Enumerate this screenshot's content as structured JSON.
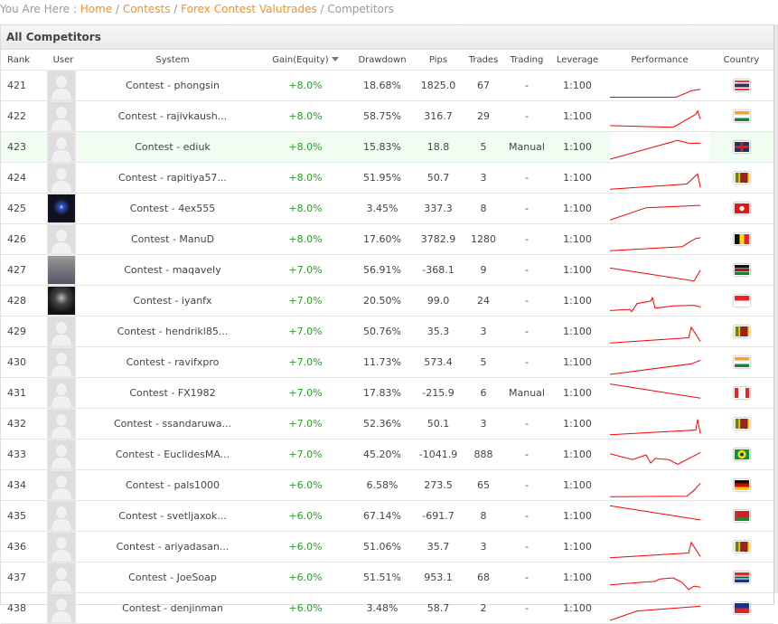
{
  "breadcrumb": {
    "prefix": "You Are Here :",
    "items": [
      "Home",
      "Contests",
      "Forex Contest Valutrades"
    ],
    "current": "Competitors"
  },
  "panel_title": "All Competitors",
  "columns": {
    "rank": "Rank",
    "user": "User",
    "system": "System",
    "gain": "Gain(Equity)",
    "drawdown": "Drawdown",
    "pips": "Pips",
    "trades": "Trades",
    "trading": "Trading",
    "leverage": "Leverage",
    "performance": "Performance",
    "country": "Country"
  },
  "colors": {
    "accent": "#f7931e",
    "gain": "#2a9d2a",
    "spark": "#ff0000",
    "highlight": "#f0fdf0"
  },
  "rows": [
    {
      "rank": "421",
      "avatar": "default",
      "system": "Contest - phongsin",
      "gain": "+8.0%",
      "drawdown": "18.68%",
      "pips": "1825.0",
      "trades": "67",
      "trading": "-",
      "leverage": "1:100",
      "country": "th",
      "perf": [
        [
          0,
          2
        ],
        [
          73,
          2
        ],
        [
          75,
          5
        ],
        [
          80,
          13
        ],
        [
          85,
          21
        ],
        [
          90,
          30
        ],
        [
          100,
          35
        ]
      ]
    },
    {
      "rank": "422",
      "avatar": "default",
      "system": "Contest - rajivkaush...",
      "gain": "+8.0%",
      "drawdown": "58.75%",
      "pips": "316.7",
      "trades": "29",
      "trading": "-",
      "leverage": "1:100",
      "country": "in",
      "perf": [
        [
          0,
          12
        ],
        [
          70,
          5
        ],
        [
          95,
          60
        ],
        [
          97,
          75
        ],
        [
          100,
          40
        ]
      ]
    },
    {
      "rank": "423",
      "avatar": "default",
      "system": "Contest - ediuk",
      "gain": "+8.0%",
      "drawdown": "15.83%",
      "pips": "18.8",
      "trades": "5",
      "trading": "Manual",
      "leverage": "1:100",
      "country": "gb",
      "highlight": true,
      "perf": [
        [
          0,
          0
        ],
        [
          75,
          80
        ],
        [
          87,
          68
        ],
        [
          100,
          68
        ]
      ]
    },
    {
      "rank": "424",
      "avatar": "default",
      "system": "Contest - rapitiya57...",
      "gain": "+8.0%",
      "drawdown": "51.95%",
      "pips": "50.7",
      "trades": "3",
      "trading": "-",
      "leverage": "1:100",
      "country": "lk",
      "perf": [
        [
          0,
          3
        ],
        [
          85,
          25
        ],
        [
          97,
          68
        ],
        [
          100,
          10
        ]
      ]
    },
    {
      "rank": "425",
      "avatar": "photo1",
      "system": "Contest - 4ex555",
      "gain": "+8.0%",
      "drawdown": "3.45%",
      "pips": "337.3",
      "trades": "8",
      "trading": "-",
      "leverage": "1:100",
      "country": "tn",
      "perf": [
        [
          0,
          3
        ],
        [
          40,
          55
        ],
        [
          100,
          65
        ]
      ]
    },
    {
      "rank": "426",
      "avatar": "default",
      "system": "Contest - ManuD",
      "gain": "+8.0%",
      "drawdown": "17.60%",
      "pips": "3782.9",
      "trades": "1280",
      "trading": "-",
      "leverage": "1:100",
      "country": "be",
      "perf": [
        [
          0,
          3
        ],
        [
          80,
          20
        ],
        [
          88,
          40
        ],
        [
          95,
          55
        ],
        [
          100,
          58
        ]
      ]
    },
    {
      "rank": "427",
      "avatar": "photo2",
      "system": "Contest - maqavely",
      "gain": "+7.0%",
      "drawdown": "56.91%",
      "pips": "-368.1",
      "trades": "9",
      "trading": "-",
      "leverage": "1:100",
      "country": "ke",
      "perf": [
        [
          0,
          60
        ],
        [
          93,
          5
        ],
        [
          100,
          50
        ]
      ]
    },
    {
      "rank": "428",
      "avatar": "photo3",
      "system": "Contest - iyanfx",
      "gain": "+7.0%",
      "drawdown": "20.50%",
      "pips": "99.0",
      "trades": "24",
      "trading": "-",
      "leverage": "1:100",
      "country": "id",
      "perf": [
        [
          0,
          10
        ],
        [
          22,
          15
        ],
        [
          24,
          5
        ],
        [
          30,
          40
        ],
        [
          45,
          50
        ],
        [
          47,
          65
        ],
        [
          50,
          20
        ],
        [
          70,
          30
        ],
        [
          93,
          32
        ],
        [
          100,
          25
        ]
      ]
    },
    {
      "rank": "429",
      "avatar": "default",
      "system": "Contest - hendrikl85...",
      "gain": "+7.0%",
      "drawdown": "50.76%",
      "pips": "35.3",
      "trades": "3",
      "trading": "-",
      "leverage": "1:100",
      "country": "lk",
      "perf": [
        [
          0,
          3
        ],
        [
          87,
          25
        ],
        [
          90,
          70
        ],
        [
          100,
          10
        ]
      ]
    },
    {
      "rank": "430",
      "avatar": "default",
      "system": "Contest - ravifxpro",
      "gain": "+7.0%",
      "drawdown": "11.73%",
      "pips": "573.4",
      "trades": "5",
      "trading": "-",
      "leverage": "1:100",
      "country": "in",
      "perf": [
        [
          0,
          0
        ],
        [
          90,
          45
        ],
        [
          100,
          60
        ]
      ]
    },
    {
      "rank": "431",
      "avatar": "default",
      "system": "Contest - FX1982",
      "gain": "+7.0%",
      "drawdown": "17.83%",
      "pips": "-215.9",
      "trades": "6",
      "trading": "Manual",
      "leverage": "1:100",
      "country": "ca",
      "perf": [
        [
          0,
          90
        ],
        [
          100,
          30
        ]
      ]
    },
    {
      "rank": "432",
      "avatar": "default",
      "system": "Contest - ssandaruwa...",
      "gain": "+7.0%",
      "drawdown": "52.36%",
      "pips": "50.1",
      "trades": "3",
      "trading": "-",
      "leverage": "1:100",
      "country": "lk",
      "perf": [
        [
          0,
          5
        ],
        [
          95,
          25
        ],
        [
          97,
          70
        ],
        [
          100,
          10
        ]
      ]
    },
    {
      "rank": "433",
      "avatar": "default",
      "system": "Contest - EuclidesMA...",
      "gain": "+7.0%",
      "drawdown": "45.20%",
      "pips": "-1041.9",
      "trades": "888",
      "trading": "-",
      "leverage": "1:100",
      "country": "br",
      "perf": [
        [
          0,
          55
        ],
        [
          25,
          30
        ],
        [
          40,
          50
        ],
        [
          45,
          15
        ],
        [
          50,
          35
        ],
        [
          65,
          30
        ],
        [
          75,
          10
        ],
        [
          100,
          60
        ]
      ]
    },
    {
      "rank": "434",
      "avatar": "default",
      "system": "Contest - pals1000",
      "gain": "+6.0%",
      "drawdown": "6.58%",
      "pips": "273.5",
      "trades": "65",
      "trading": "-",
      "leverage": "1:100",
      "country": "de",
      "perf": [
        [
          0,
          3
        ],
        [
          85,
          5
        ],
        [
          93,
          30
        ],
        [
          100,
          60
        ]
      ]
    },
    {
      "rank": "435",
      "avatar": "default",
      "system": "Contest - svetljaxok...",
      "gain": "+6.0%",
      "drawdown": "67.14%",
      "pips": "-691.7",
      "trades": "8",
      "trading": "-",
      "leverage": "1:100",
      "country": "by",
      "perf": [
        [
          0,
          95
        ],
        [
          100,
          35
        ]
      ]
    },
    {
      "rank": "436",
      "avatar": "default",
      "system": "Contest - ariyadasan...",
      "gain": "+6.0%",
      "drawdown": "51.06%",
      "pips": "35.7",
      "trades": "3",
      "trading": "-",
      "leverage": "1:100",
      "country": "lk",
      "perf": [
        [
          0,
          5
        ],
        [
          87,
          25
        ],
        [
          90,
          70
        ],
        [
          100,
          10
        ]
      ]
    },
    {
      "rank": "437",
      "avatar": "default",
      "system": "Contest - JoeSoap",
      "gain": "+6.0%",
      "drawdown": "51.51%",
      "pips": "953.1",
      "trades": "68",
      "trading": "-",
      "leverage": "1:100",
      "country": "za",
      "perf": [
        [
          0,
          20
        ],
        [
          30,
          30
        ],
        [
          50,
          35
        ],
        [
          55,
          45
        ],
        [
          70,
          50
        ],
        [
          80,
          30
        ],
        [
          87,
          0
        ],
        [
          93,
          15
        ],
        [
          100,
          10
        ]
      ]
    },
    {
      "rank": "438",
      "avatar": "default",
      "system": "Contest - denjinman",
      "gain": "+6.0%",
      "drawdown": "3.48%",
      "pips": "58.7",
      "trades": "2",
      "trading": "-",
      "leverage": "1:100",
      "country": "ph",
      "perf": [
        [
          0,
          0
        ],
        [
          30,
          40
        ],
        [
          100,
          60
        ]
      ]
    }
  ]
}
